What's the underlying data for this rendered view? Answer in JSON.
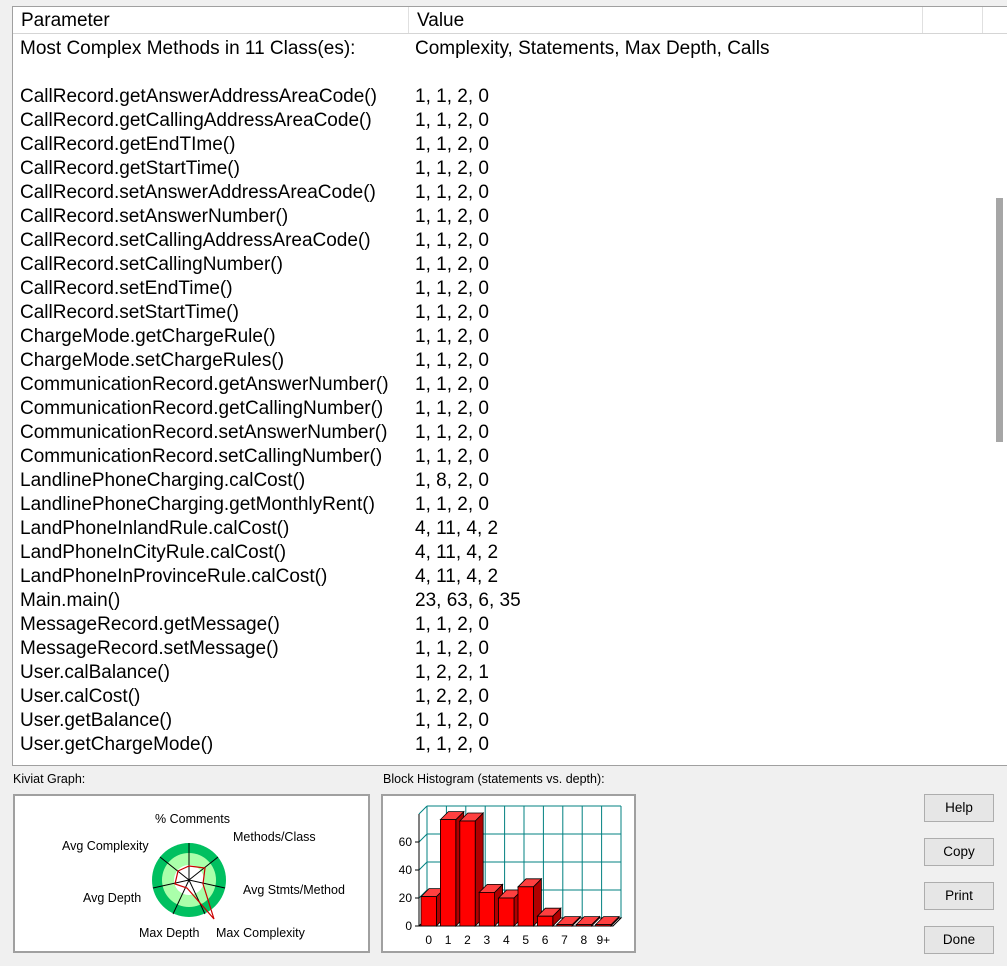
{
  "table": {
    "columns": {
      "parameter": "Parameter",
      "value": "Value"
    },
    "rows": [
      {
        "p": "Most Complex Methods in 11 Class(es):",
        "v": "Complexity, Statements, Max Depth, Calls"
      },
      {
        "p": "",
        "v": ""
      },
      {
        "p": "CallRecord.getAnswerAddressAreaCode()",
        "v": "1, 1, 2, 0"
      },
      {
        "p": "CallRecord.getCallingAddressAreaCode()",
        "v": "1, 1, 2, 0"
      },
      {
        "p": "CallRecord.getEndTIme()",
        "v": "1, 1, 2, 0"
      },
      {
        "p": "CallRecord.getStartTime()",
        "v": "1, 1, 2, 0"
      },
      {
        "p": "CallRecord.setAnswerAddressAreaCode()",
        "v": "1, 1, 2, 0"
      },
      {
        "p": "CallRecord.setAnswerNumber()",
        "v": "1, 1, 2, 0"
      },
      {
        "p": "CallRecord.setCallingAddressAreaCode()",
        "v": "1, 1, 2, 0"
      },
      {
        "p": "CallRecord.setCallingNumber()",
        "v": "1, 1, 2, 0"
      },
      {
        "p": "CallRecord.setEndTime()",
        "v": "1, 1, 2, 0"
      },
      {
        "p": "CallRecord.setStartTime()",
        "v": "1, 1, 2, 0"
      },
      {
        "p": "ChargeMode.getChargeRule()",
        "v": "1, 1, 2, 0"
      },
      {
        "p": "ChargeMode.setChargeRules()",
        "v": "1, 1, 2, 0"
      },
      {
        "p": "CommunicationRecord.getAnswerNumber()",
        "v": "1, 1, 2, 0"
      },
      {
        "p": "CommunicationRecord.getCallingNumber()",
        "v": "1, 1, 2, 0"
      },
      {
        "p": "CommunicationRecord.setAnswerNumber()",
        "v": "1, 1, 2, 0"
      },
      {
        "p": "CommunicationRecord.setCallingNumber()",
        "v": "1, 1, 2, 0"
      },
      {
        "p": "LandlinePhoneCharging.calCost()",
        "v": "1, 8, 2, 0"
      },
      {
        "p": "LandlinePhoneCharging.getMonthlyRent()",
        "v": "1, 1, 2, 0"
      },
      {
        "p": "LandPhoneInlandRule.calCost()",
        "v": "4, 11, 4, 2"
      },
      {
        "p": "LandPhoneInCityRule.calCost()",
        "v": "4, 11, 4, 2"
      },
      {
        "p": "LandPhoneInProvinceRule.calCost()",
        "v": "4, 11, 4, 2"
      },
      {
        "p": "Main.main()",
        "v": "23, 63, 6, 35"
      },
      {
        "p": "MessageRecord.getMessage()",
        "v": "1, 1, 2, 0"
      },
      {
        "p": "MessageRecord.setMessage()",
        "v": "1, 1, 2, 0"
      },
      {
        "p": "User.calBalance()",
        "v": "1, 2, 2, 1"
      },
      {
        "p": "User.calCost()",
        "v": "1, 2, 2, 0"
      },
      {
        "p": "User.getBalance()",
        "v": "1, 1, 2, 0"
      },
      {
        "p": "User.getChargeMode()",
        "v": "1, 1, 2, 0"
      }
    ]
  },
  "kiviat": {
    "title": "Kiviat Graph:",
    "labels": {
      "comments": "% Comments",
      "methods_class": "Methods/Class",
      "avg_stmts": "Avg Stmts/Method",
      "max_complexity": "Max Complexity",
      "max_depth": "Max Depth",
      "avg_depth": "Avg Depth",
      "avg_complexity": "Avg Complexity"
    }
  },
  "histogram": {
    "title": "Block Histogram (statements vs. depth):",
    "y_ticks": [
      "0",
      "20",
      "40",
      "60"
    ],
    "categories": [
      "0",
      "1",
      "2",
      "3",
      "4",
      "5",
      "6",
      "7",
      "8",
      "9+"
    ],
    "values": [
      21,
      76,
      75,
      24,
      20,
      28,
      7,
      1,
      1,
      1
    ],
    "ylim": [
      0,
      80
    ],
    "bar_color": "#ff0000",
    "grid_color": "#008080"
  },
  "buttons": {
    "help": "Help",
    "copy": "Copy",
    "print": "Print",
    "done": "Done"
  }
}
